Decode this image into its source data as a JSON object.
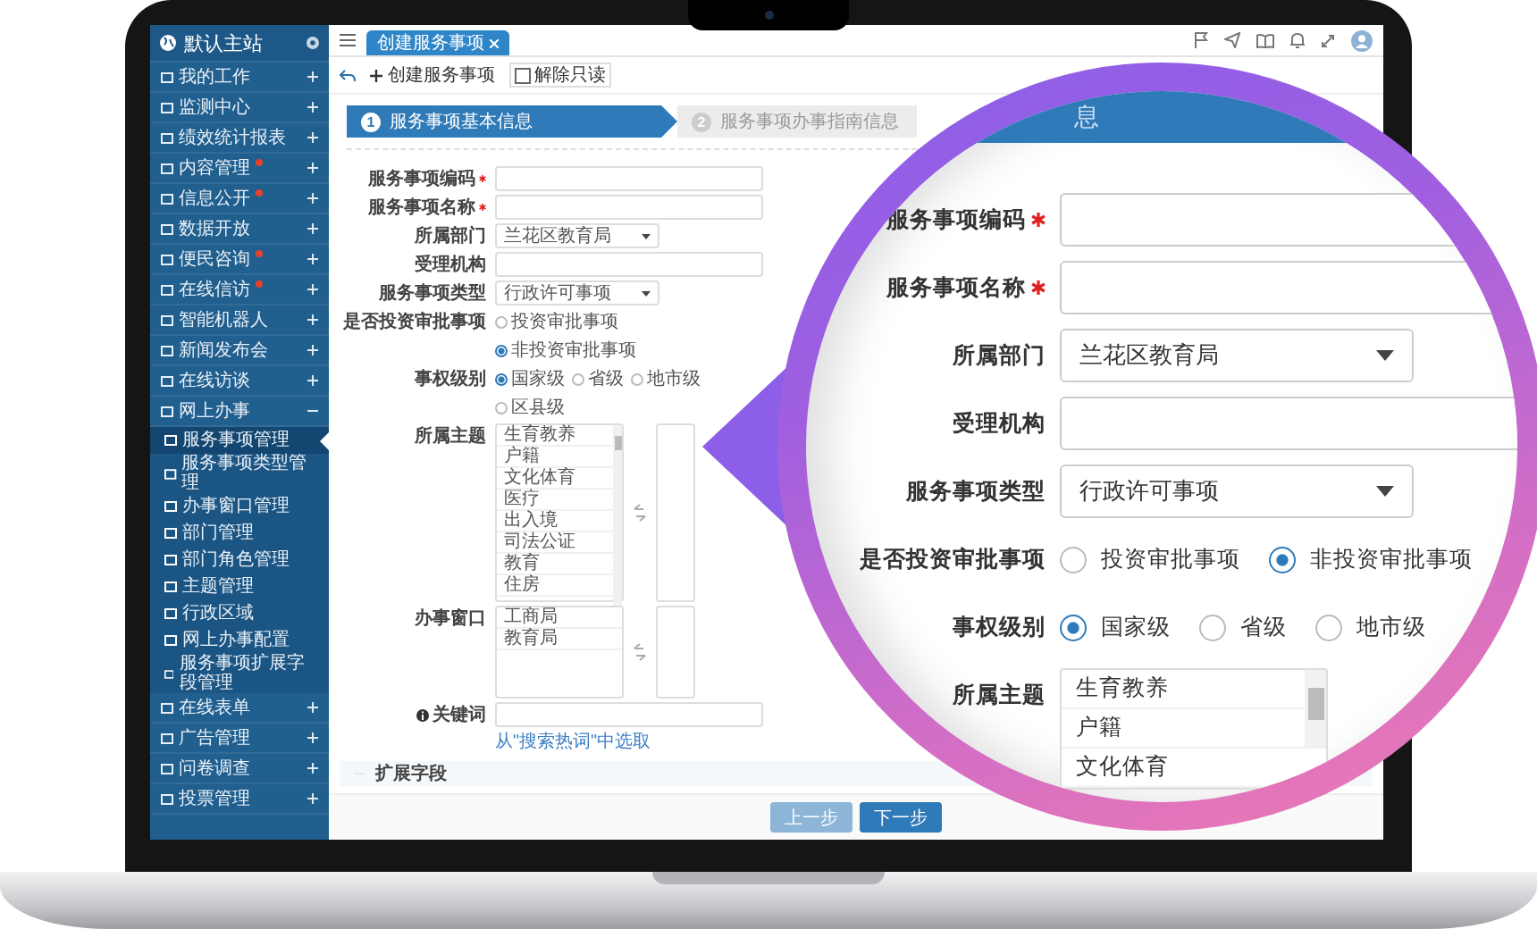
{
  "sidebar": {
    "title": "默认主站",
    "items": [
      {
        "label": "我的工作",
        "notice": false,
        "expanded": false
      },
      {
        "label": "监测中心",
        "notice": false,
        "expanded": false
      },
      {
        "label": "绩效统计报表",
        "notice": false,
        "expanded": false
      },
      {
        "label": "内容管理",
        "notice": true,
        "expanded": false
      },
      {
        "label": "信息公开",
        "notice": true,
        "expanded": false
      },
      {
        "label": "数据开放",
        "notice": false,
        "expanded": false
      },
      {
        "label": "便民咨询",
        "notice": true,
        "expanded": false
      },
      {
        "label": "在线信访",
        "notice": true,
        "expanded": false
      },
      {
        "label": "智能机器人",
        "notice": false,
        "expanded": false
      },
      {
        "label": "新闻发布会",
        "notice": false,
        "expanded": false
      },
      {
        "label": "在线访谈",
        "notice": false,
        "expanded": false
      },
      {
        "label": "网上办事",
        "notice": false,
        "expanded": true,
        "children": [
          {
            "label": "服务事项管理",
            "selected": true
          },
          {
            "label": "服务事项类型管理",
            "selected": false
          },
          {
            "label": "办事窗口管理",
            "selected": false
          },
          {
            "label": "部门管理",
            "selected": false
          },
          {
            "label": "部门角色管理",
            "selected": false
          },
          {
            "label": "主题管理",
            "selected": false
          },
          {
            "label": "行政区域",
            "selected": false
          },
          {
            "label": "网上办事配置",
            "selected": false
          },
          {
            "label": "服务事项扩展字段管理",
            "selected": false
          }
        ]
      },
      {
        "label": "在线表单",
        "notice": false,
        "expanded": false
      },
      {
        "label": "广告管理",
        "notice": false,
        "expanded": false
      },
      {
        "label": "问卷调查",
        "notice": false,
        "expanded": false
      },
      {
        "label": "投票管理",
        "notice": false,
        "expanded": false
      }
    ]
  },
  "top_bar": {
    "tabs": [
      {
        "label": "创建服务事项",
        "selected": true
      }
    ]
  },
  "toolbar": {
    "create_button": "创建服务事项",
    "readonly_checkbox": {
      "label": "解除只读",
      "checked": false
    }
  },
  "steps": [
    {
      "number": "1",
      "label": "服务事项基本信息",
      "selected": true
    },
    {
      "number": "2",
      "label": "服务事项办事指南信息",
      "selected": false
    }
  ],
  "form": {
    "rows": [
      {
        "label": "服务事项编码",
        "required": true,
        "kind": "text"
      },
      {
        "label": "服务事项名称",
        "required": true,
        "kind": "text"
      },
      {
        "label": "所属部门",
        "required": false,
        "kind": "select",
        "value": "兰花区教育局"
      },
      {
        "label": "受理机构",
        "required": false,
        "kind": "text"
      },
      {
        "label": "服务事项类型",
        "required": false,
        "kind": "select",
        "value": "行政许可事项"
      },
      {
        "label": "是否投资审批事项",
        "required": false,
        "kind": "radio",
        "options": [
          {
            "label": "投资审批事项",
            "selected": false
          },
          {
            "label": "非投资审批事项",
            "selected": true
          }
        ]
      },
      {
        "label": "事权级别",
        "required": false,
        "kind": "radio",
        "options": [
          {
            "label": "国家级",
            "selected": true
          },
          {
            "label": "省级",
            "selected": false
          },
          {
            "label": "地市级",
            "selected": false
          },
          {
            "label": "区县级",
            "selected": false
          }
        ]
      },
      {
        "label": "所属主题",
        "required": false,
        "kind": "transfer",
        "items": [
          "生育教养",
          "户籍",
          "文化体育",
          "医疗",
          "出入境",
          "司法公证",
          "教育",
          "住房"
        ]
      },
      {
        "label": "办事窗口",
        "required": false,
        "kind": "transfer",
        "items": [
          "工商局",
          "教育局"
        ]
      },
      {
        "label": "关键词",
        "required": false,
        "kind": "keyword",
        "hint": "从\"搜索热词\"中选取"
      }
    ]
  },
  "extension_section": {
    "label": "扩展字段",
    "expanded": true
  },
  "buttons": [
    {
      "label": "上一步",
      "disabled": true
    },
    {
      "label": "下一步",
      "disabled": false
    }
  ],
  "magnifier": {
    "step_fragment": "息",
    "rows": [
      {
        "label": "服务事项编码",
        "required": true,
        "kind": "text"
      },
      {
        "label": "服务事项名称",
        "required": true,
        "kind": "text"
      },
      {
        "label": "所属部门",
        "required": false,
        "kind": "select",
        "value": "兰花区教育局"
      },
      {
        "label": "受理机构",
        "required": false,
        "kind": "text"
      },
      {
        "label": "服务事项类型",
        "required": false,
        "kind": "select",
        "value": "行政许可事项"
      },
      {
        "label": "是否投资审批事项",
        "required": false,
        "kind": "radio",
        "options": [
          {
            "label": "投资审批事项",
            "selected": false
          },
          {
            "label": "非投资审批事项",
            "selected": true
          }
        ]
      },
      {
        "label": "事权级别",
        "required": false,
        "kind": "radio",
        "options": [
          {
            "label": "国家级",
            "selected": true
          },
          {
            "label": "省级",
            "selected": false
          },
          {
            "label": "地市级",
            "selected": false
          }
        ]
      },
      {
        "label": "所属主题",
        "required": false,
        "kind": "transfer",
        "items": [
          "生育教养",
          "户籍",
          "文化体育"
        ]
      }
    ]
  }
}
